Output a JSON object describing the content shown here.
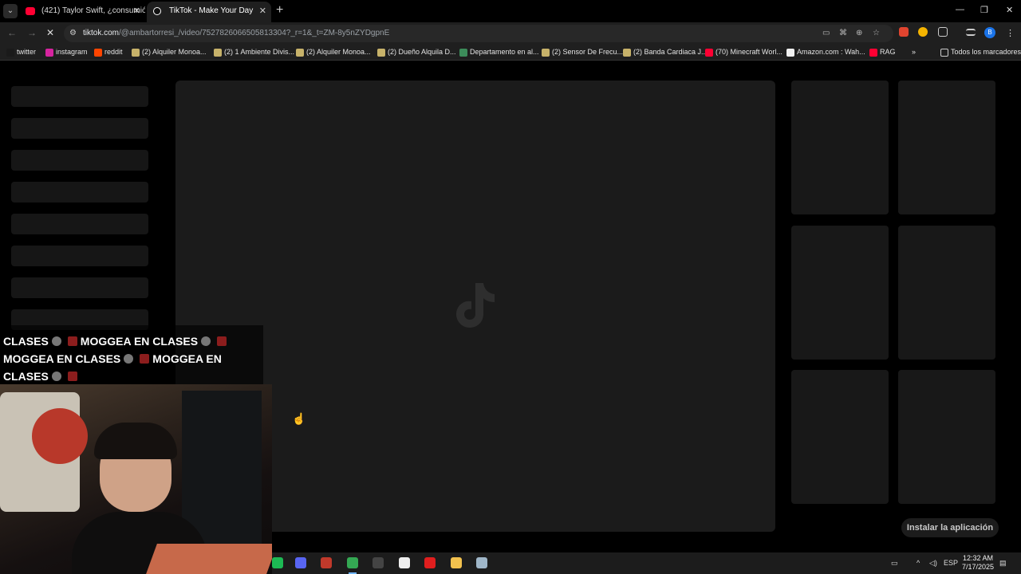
{
  "browser": {
    "tabs": [
      {
        "title": "(421) Taylor Swift, ¿consumió d",
        "close": "✕"
      },
      {
        "title": "TikTok - Make Your Day",
        "close": "✕"
      }
    ],
    "new_tab": "+",
    "window_controls": {
      "minimize": "—",
      "restore": "❐",
      "close": "✕"
    },
    "nav": {
      "back": "←",
      "forward": "→",
      "loading": "✕"
    },
    "address": {
      "domain": "tiktok.com",
      "path": "/@ambartorresi_/video/7527826066505813304?_r=1&_t=ZM-8y5nZYDgpnE"
    },
    "profile_initial": "B",
    "bookmarks": [
      {
        "label": "twitter",
        "color": "#1a1a1a"
      },
      {
        "label": "instagram",
        "color": "#d6249f"
      },
      {
        "label": "reddit",
        "color": "#ff4500"
      },
      {
        "label": "(2) Alquiler Monoa...",
        "color": "#c7b26a"
      },
      {
        "label": "(2) 1 Ambiente Divis...",
        "color": "#c7b26a"
      },
      {
        "label": "(2) Alquiler Monoa...",
        "color": "#c7b26a"
      },
      {
        "label": "(2) Dueño Alquila D...",
        "color": "#c7b26a"
      },
      {
        "label": "Departamento en al...",
        "color": "#3c8c5a"
      },
      {
        "label": "(2) Sensor De Frecu...",
        "color": "#c7b26a"
      },
      {
        "label": "(2) Banda Cardiaca J...",
        "color": "#c7b26a"
      },
      {
        "label": "(70) Minecraft Worl...",
        "color": "#ff0033"
      },
      {
        "label": "Amazon.com : Wah...",
        "color": "#f0f0f0"
      },
      {
        "label": "RAG",
        "color": "#ff0033"
      }
    ],
    "bookmarks_more": "»",
    "all_bookmarks": "Todos los marcadores"
  },
  "tiktok": {
    "install_button": "Instalar la aplicación"
  },
  "stream_overlay": {
    "line1": "CLASES",
    "line1b": "MOGGEA EN CLASES",
    "line2": "MOGGEA EN CLASES",
    "line2b": "MOGGEA EN",
    "line3": "CLASES"
  },
  "taskbar": {
    "apps": [
      {
        "name": "spotify",
        "color": "#1db954"
      },
      {
        "name": "discord",
        "color": "#5865f2"
      },
      {
        "name": "streamer-app",
        "color": "#c0392b"
      },
      {
        "name": "chrome",
        "color": "#34a853"
      },
      {
        "name": "obs",
        "color": "#444"
      },
      {
        "name": "capcut",
        "color": "#eee"
      },
      {
        "name": "opera",
        "color": "#e01e1e"
      },
      {
        "name": "file-explorer",
        "color": "#f2c14e"
      },
      {
        "name": "gpu-app",
        "color": "#9fb6c8"
      }
    ],
    "language": "ESP",
    "time": "12:32 AM",
    "date": "7/17/2025"
  }
}
